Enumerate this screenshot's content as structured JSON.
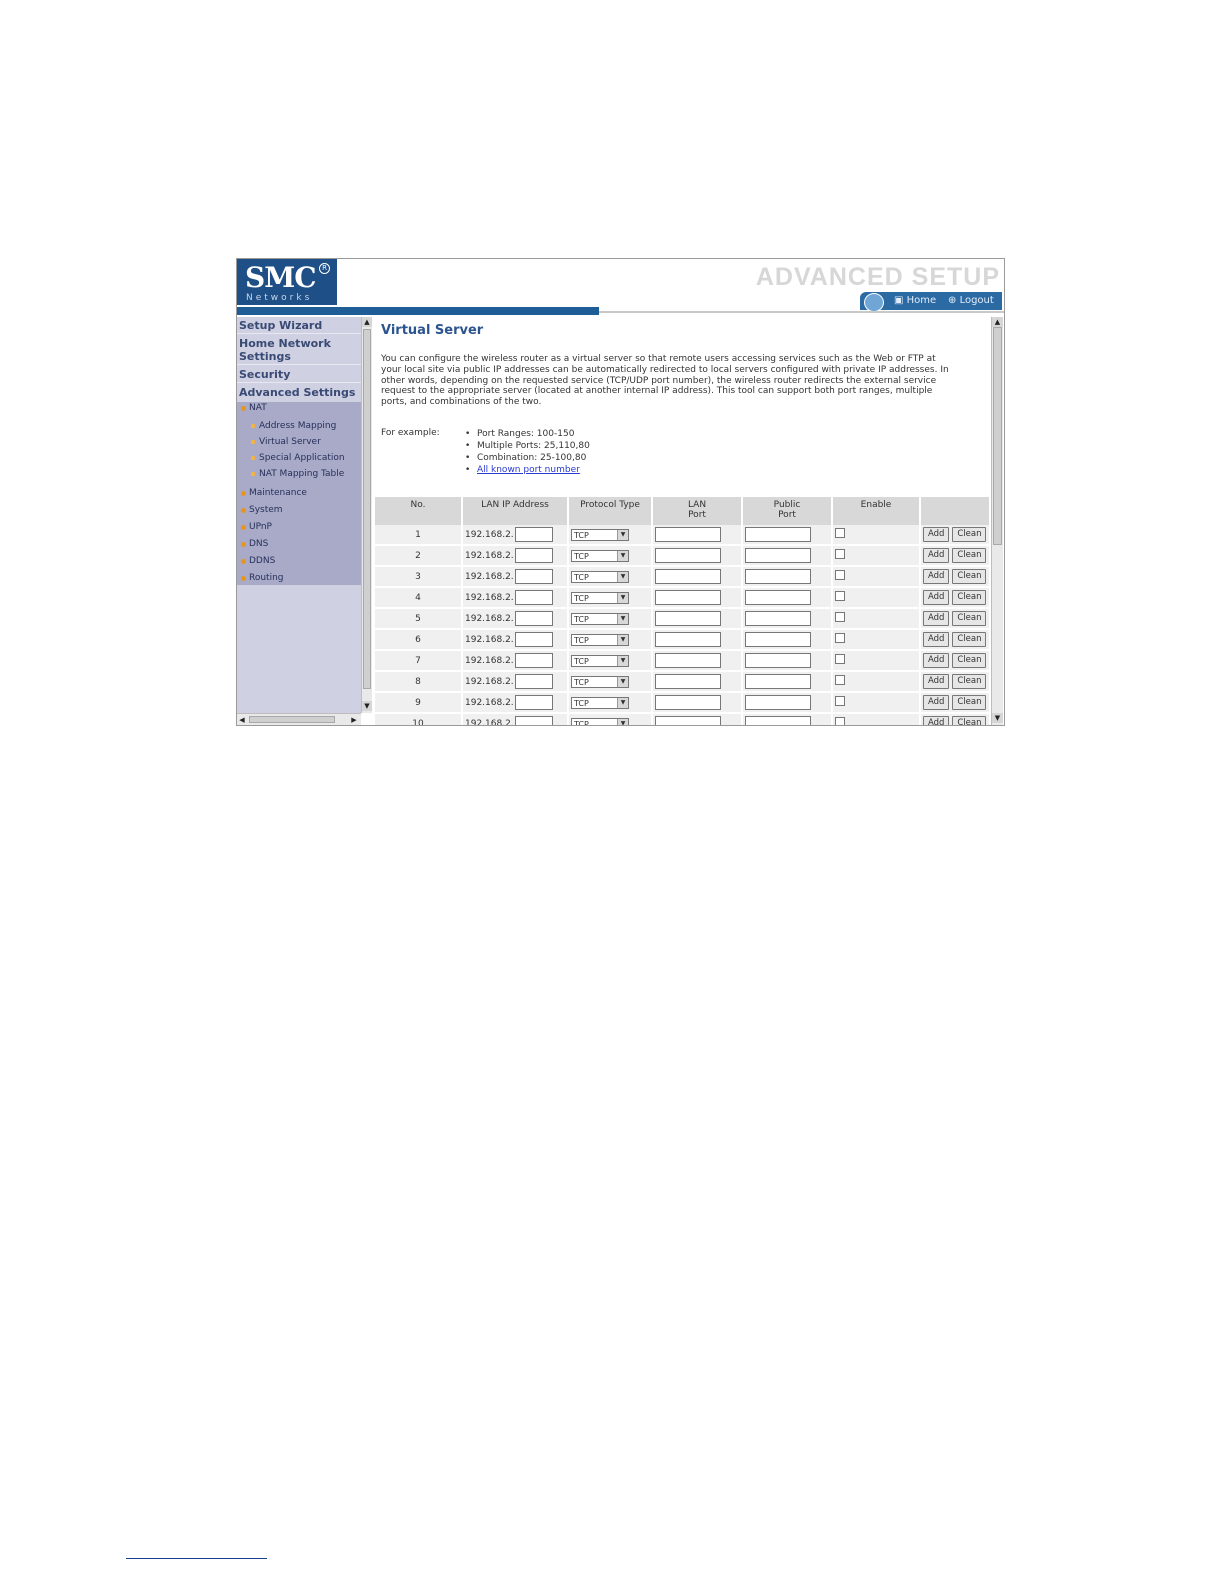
{
  "header": {
    "logo": "SMC",
    "logo_sub": "Networks",
    "logo_reg": "R",
    "title_banner": "ADVANCED SETUP",
    "home_label": "Home",
    "logout_label": "Logout"
  },
  "sidebar": {
    "main_items": [
      "Setup Wizard",
      "Home Network Settings",
      "Security",
      "Advanced Settings"
    ],
    "nat_label": "NAT",
    "nat_sub": [
      "Address Mapping",
      "Virtual Server",
      "Special Application",
      "NAT Mapping Table"
    ],
    "other_items": [
      "Maintenance",
      "System",
      "UPnP",
      "DNS",
      "DDNS",
      "Routing"
    ]
  },
  "main": {
    "title": "Virtual Server",
    "description": "You can configure the wireless router as a virtual server so that remote users accessing services such as the Web or FTP at your local site via public IP addresses can be automatically redirected to local servers configured with private IP addresses. In other words, depending on the requested service (TCP/UDP port number), the wireless router redirects the external service request to the appropriate server (located at another internal IP address). This tool can support both port ranges, multiple ports, and combinations of the two.",
    "example_label": "For example:",
    "examples": [
      "Port Ranges: 100-150",
      "Multiple Ports: 25,110,80",
      "Combination: 25-100,80"
    ],
    "example_link": "All known port number"
  },
  "table": {
    "headers": [
      "No.",
      "LAN IP Address",
      "Protocol Type",
      "LAN Port",
      "Public Port",
      "Enable",
      ""
    ],
    "ip_prefix": "192.168.2.",
    "protocol": "TCP",
    "add_label": "Add",
    "clean_label": "Clean",
    "rows": [
      "1",
      "2",
      "3",
      "4",
      "5",
      "6",
      "7",
      "8",
      "9",
      "10"
    ]
  }
}
